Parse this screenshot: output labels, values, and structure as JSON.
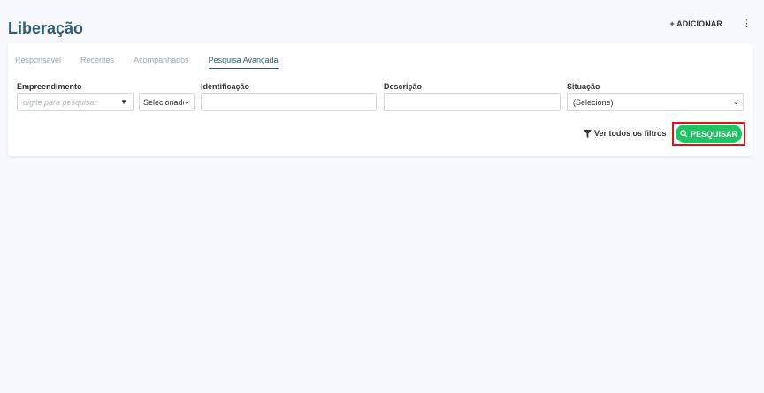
{
  "page": {
    "title": "Liberação"
  },
  "header": {
    "add_label": "+ ADICIONAR",
    "more_icon": "⋮"
  },
  "tabs": [
    {
      "label": "Responsável",
      "active": false
    },
    {
      "label": "Recentes",
      "active": false
    },
    {
      "label": "Acompanhados",
      "active": false
    },
    {
      "label": "Pesquisa Avançada",
      "active": true
    }
  ],
  "filters": {
    "empreendimento": {
      "label": "Empreendimento",
      "placeholder": "digite para pesquisar",
      "mode_value": "Selecionado"
    },
    "identificacao": {
      "label": "Identificação",
      "value": ""
    },
    "descricao": {
      "label": "Descrição",
      "value": ""
    },
    "situacao": {
      "label": "Situação",
      "value": "(Selecione)"
    }
  },
  "actions": {
    "view_filters_label": "Ver todos os filtros",
    "search_label": "PESQUISAR"
  },
  "colors": {
    "accent": "#2f5d78",
    "search_button": "#1ec463",
    "highlight": "#e0121b"
  }
}
